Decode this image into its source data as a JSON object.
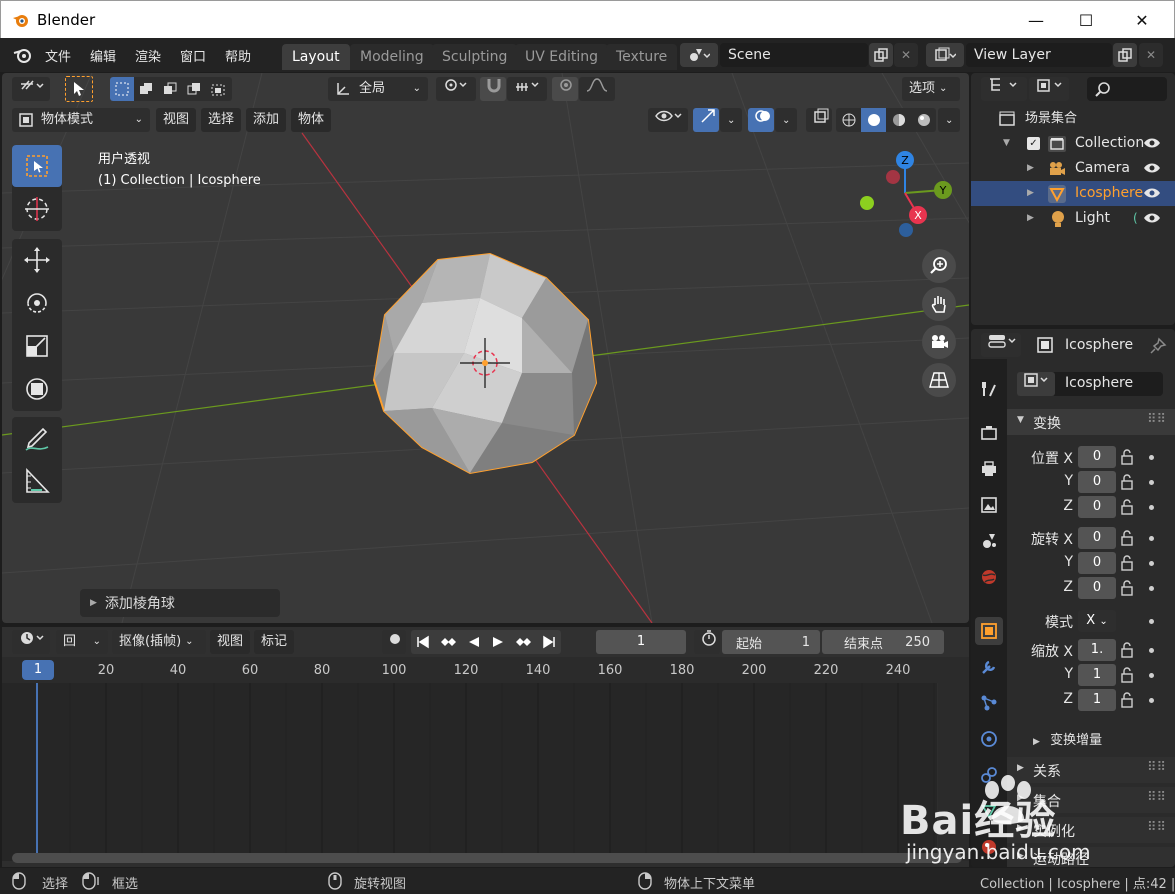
{
  "window": {
    "title": "Blender",
    "minimize": "—",
    "maximize": "☐",
    "close": "✕"
  },
  "menu": [
    "文件",
    "编辑",
    "渲染",
    "窗口",
    "帮助"
  ],
  "workspaces": [
    "Layout",
    "Modeling",
    "Sculpting",
    "UV Editing",
    "Texture"
  ],
  "scene": {
    "name": "Scene"
  },
  "view_layer": {
    "name": "View Layer"
  },
  "viewport": {
    "orientation": "全局",
    "options": "选项",
    "mode": "物体模式",
    "menus": [
      "视图",
      "选择",
      "添加",
      "物体"
    ],
    "info_line1": "用户透视",
    "info_line2": "(1) Collection | Icosphere",
    "last_op": "添加棱角球",
    "gizmo": {
      "x": "X",
      "y": "Y",
      "z": "Z"
    }
  },
  "timeline": {
    "menus": [
      "回放",
      "抠像(插帧)",
      "视图",
      "标记"
    ],
    "current_frame": "1",
    "start_label": "起始",
    "start": "1",
    "end_label": "结束点",
    "end": "250",
    "ruler": [
      "20",
      "40",
      "60",
      "80",
      "100",
      "120",
      "140",
      "160",
      "180",
      "200",
      "220",
      "240"
    ],
    "playhead": "1"
  },
  "status": {
    "select": "选择",
    "box_select": "框选",
    "rotate_view": "旋转视图",
    "context_menu": "物体上下文菜单",
    "right": "Collection | Icosphere | 点:42 |"
  },
  "outliner": {
    "root": "场景集合",
    "items": [
      {
        "name": "Collection"
      },
      {
        "name": "Camera"
      },
      {
        "name": "Icosphere"
      },
      {
        "name": "Light"
      }
    ]
  },
  "properties": {
    "header_object": "Icosphere",
    "object_name": "Icosphere",
    "transform_title": "变换",
    "location_label": "位置 X",
    "rotation_label": "旋转 X",
    "scale_label": "缩放 X",
    "y_label": "Y",
    "z_label": "Z",
    "location": [
      "0",
      "0",
      "0"
    ],
    "rotation": [
      "0",
      "0",
      "0"
    ],
    "mode_label": "模式",
    "mode_value": "X",
    "scale": [
      "1.",
      "1",
      "1"
    ],
    "delta_transform": "变换增量",
    "relations": "关系",
    "collections": "集合",
    "instancing": "实例化",
    "motion_paths": "运动路径"
  },
  "watermark": {
    "text": "Bai经验",
    "url": "jingyan.baidu.com"
  },
  "colors": {
    "accent": "#4772b3",
    "selection": "#ffa02e",
    "x_axis": "#e8344f",
    "y_axis": "#6b9a1e",
    "z_axis": "#2f84e3"
  }
}
